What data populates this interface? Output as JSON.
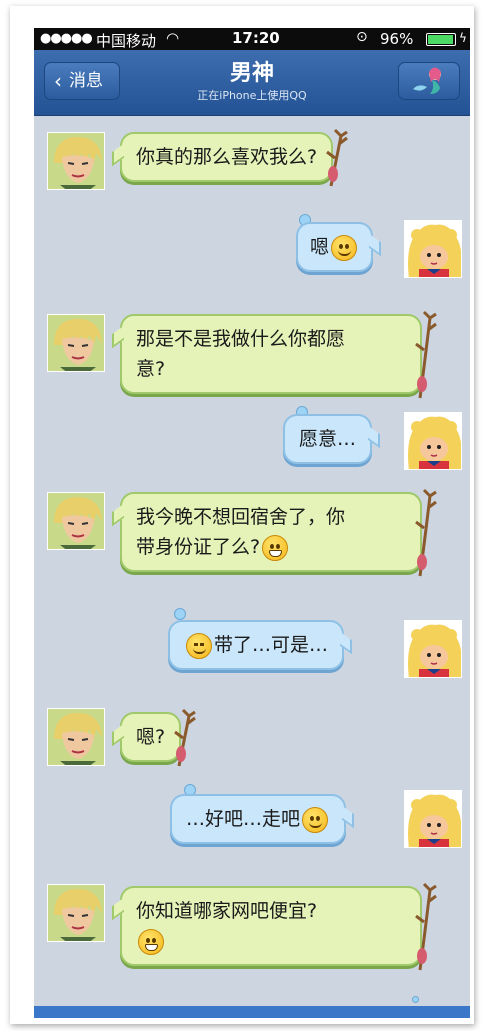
{
  "status": {
    "carrier": "中国移动",
    "time": "17:20",
    "battery": "96%",
    "battery_level": 0.96
  },
  "nav": {
    "back_label": "消息",
    "title": "男神",
    "subtitle": "正在iPhone上使用QQ"
  },
  "messages": [
    {
      "side": "left",
      "text": "你真的那么喜欢我么?",
      "emoji": ""
    },
    {
      "side": "right",
      "text": "嗯",
      "emoji": "smile-emoji"
    },
    {
      "side": "left",
      "text": "那是不是我做什么你都愿意?",
      "emoji": ""
    },
    {
      "side": "right",
      "text": "愿意…",
      "emoji": ""
    },
    {
      "side": "left",
      "text": "我今晚不想回宿舍了，你带身份证了么?",
      "emoji": "grin-emoji"
    },
    {
      "side": "right",
      "text": "带了…可是…",
      "emoji": "angry-emoji"
    },
    {
      "side": "left",
      "text": "嗯?",
      "emoji": ""
    },
    {
      "side": "right",
      "text": "…好吧…走吧",
      "emoji": "dizzy-emoji"
    },
    {
      "side": "left",
      "text": "你知道哪家网吧便宜?",
      "emoji": "grin-emoji"
    }
  ],
  "msg_lines": {
    "m2a": "那是不是我做什么你都愿",
    "m2b": "意?",
    "m4a": "我今晚不想回宿舍了，你",
    "m4b": "带身份证了么?"
  },
  "colors": {
    "nav": "#2f5fa2",
    "chat_bg": "#cdd6e0",
    "friend_bubble": "#e6f3b8",
    "my_bubble": "#c9e6fb"
  }
}
